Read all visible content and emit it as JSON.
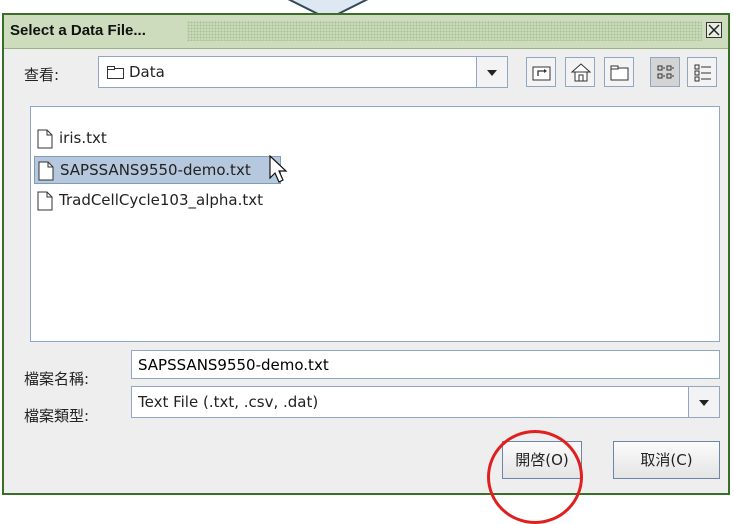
{
  "dialog": {
    "title": "Select a Data File...",
    "close_icon": "close-icon"
  },
  "lookin": {
    "label": "查看:",
    "value": "Data",
    "folder_icon": "folder-icon",
    "toolbar": [
      "up-folder-icon",
      "home-icon",
      "new-folder-icon",
      "list-view-icon",
      "details-view-icon"
    ]
  },
  "files": [
    {
      "name": "iris.txt",
      "selected": false
    },
    {
      "name": "SAPSSANS9550-demo.txt",
      "selected": true
    },
    {
      "name": "TradCellCycle103_alpha.txt",
      "selected": false
    }
  ],
  "filename": {
    "label": "檔案名稱:",
    "value": "SAPSSANS9550-demo.txt"
  },
  "filetype": {
    "label": "檔案類型:",
    "value": "Text File (.txt, .csv, .dat)"
  },
  "buttons": {
    "open": "開啓(O)",
    "cancel": "取消(C)"
  },
  "colors": {
    "titlebar": "#ccdcbc",
    "selection": "#b6c8de",
    "highlight": "#e02020"
  }
}
